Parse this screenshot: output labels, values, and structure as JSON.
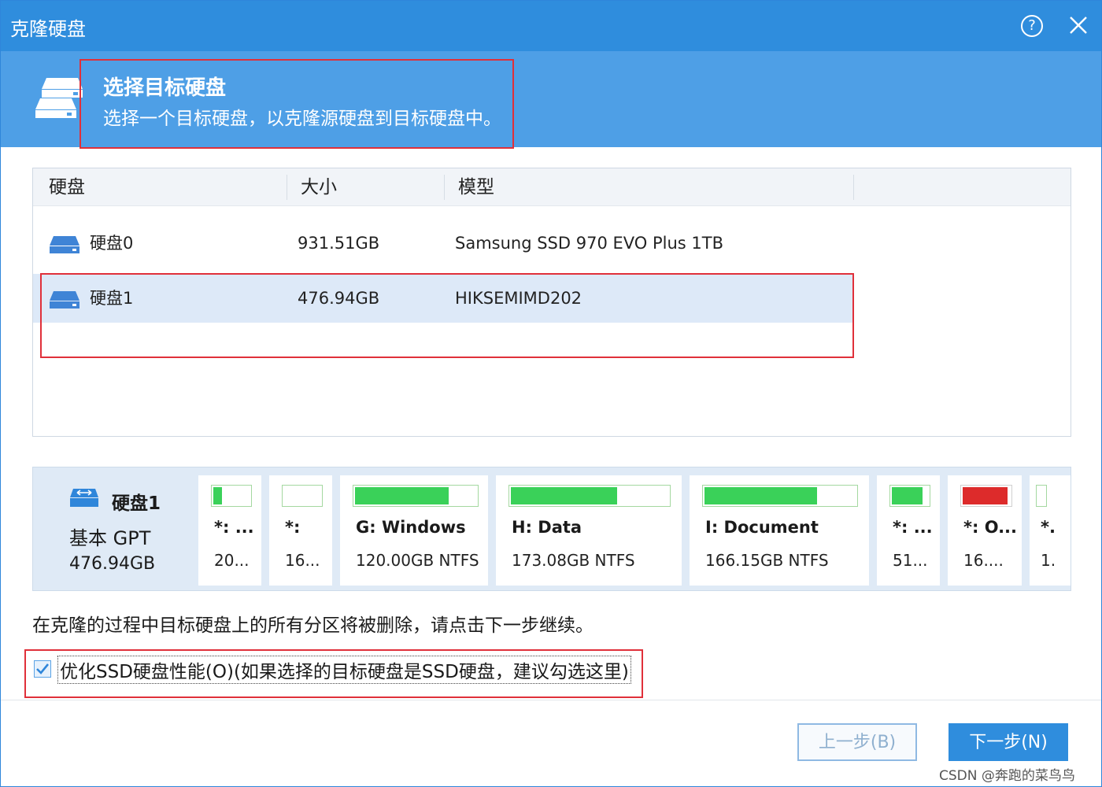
{
  "window": {
    "title": "克隆硬盘",
    "help_label": "?"
  },
  "header": {
    "title": "选择目标硬盘",
    "subtitle": "选择一个目标硬盘，以克隆源硬盘到目标硬盘中。"
  },
  "table": {
    "columns": [
      "硬盘",
      "大小",
      "模型"
    ],
    "rows": [
      {
        "name": "硬盘0",
        "size": "931.51GB",
        "model": "Samsung SSD 970 EVO Plus 1TB",
        "selected": false
      },
      {
        "name": "硬盘1",
        "size": "476.94GB",
        "model": "HIKSEMIMD202",
        "selected": true
      }
    ]
  },
  "disk_map": {
    "name": "硬盘1",
    "type": "基本 GPT",
    "size": "476.94GB",
    "partitions": [
      {
        "name": "*: ...",
        "size": "20...",
        "used": 0.3,
        "color": "#3ad159"
      },
      {
        "name": "*:",
        "size": "16...",
        "used": 0.0,
        "color": "#3ad159"
      },
      {
        "name": "G: Windows",
        "size": "120.00GB NTFS",
        "used": 0.78,
        "color": "#3ad159"
      },
      {
        "name": "H: Data",
        "size": "173.08GB NTFS",
        "used": 0.68,
        "color": "#3ad159"
      },
      {
        "name": "I: Document",
        "size": "166.15GB NTFS",
        "used": 0.75,
        "color": "#3ad159"
      },
      {
        "name": "*: ...",
        "size": "51...",
        "used": 0.85,
        "color": "#3ad159"
      },
      {
        "name": "*: O...",
        "size": "16....",
        "used": 0.95,
        "color": "#dd2b2b"
      },
      {
        "name": "*.",
        "size": "1.",
        "used": 0.0,
        "color": "#3ad159"
      }
    ]
  },
  "notice": "在克隆的过程中目标硬盘上的所有分区将被删除，请点击下一步继续。",
  "optimize_ssd": {
    "checked": true,
    "label": "优化SSD硬盘性能(O)(如果选择的目标硬盘是SSD硬盘，建议勾选这里)"
  },
  "buttons": {
    "back": "上一步(B)",
    "next": "下一步(N)"
  },
  "watermark": "CSDN @奔跑的菜鸟鸟"
}
